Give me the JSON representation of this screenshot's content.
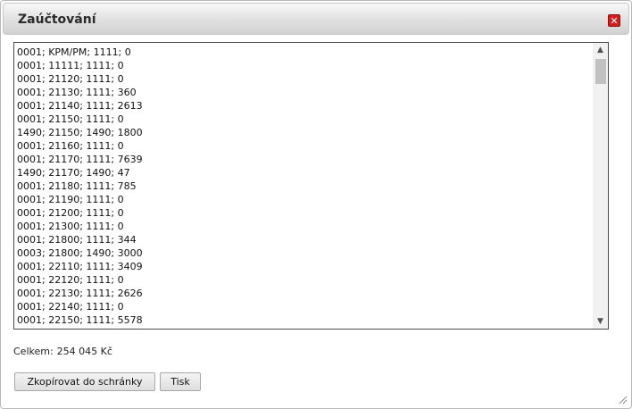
{
  "dialog": {
    "title": "Zaúčtování",
    "close_icon": "close-icon",
    "close_color": "#cf1f1f"
  },
  "textarea": {
    "lines": [
      "0001; KPM/PM; 1111; 0",
      "0001; 11111; 1111; 0",
      "0001; 21120; 1111; 0",
      "0001; 21130; 1111; 360",
      "0001; 21140; 1111; 2613",
      "0001; 21150; 1111; 0",
      "1490; 21150; 1490; 1800",
      "0001; 21160; 1111; 0",
      "0001; 21170; 1111; 7639",
      "1490; 21170; 1490; 47",
      "0001; 21180; 1111; 785",
      "0001; 21190; 1111; 0",
      "0001; 21200; 1111; 0",
      "0001; 21300; 1111; 0",
      "0001; 21800; 1111; 344",
      "0003; 21800; 1490; 3000",
      "0001; 22110; 1111; 3409",
      "0001; 22120; 1111; 0",
      "0001; 22130; 1111; 2626",
      "0001; 22140; 1111; 0",
      "0001; 22150; 1111; 5578"
    ]
  },
  "summary": {
    "label": "Celkem:",
    "value": "254 045 Kč"
  },
  "buttons": {
    "copy_label": "Zkopírovat do schránky",
    "print_label": "Tisk"
  }
}
